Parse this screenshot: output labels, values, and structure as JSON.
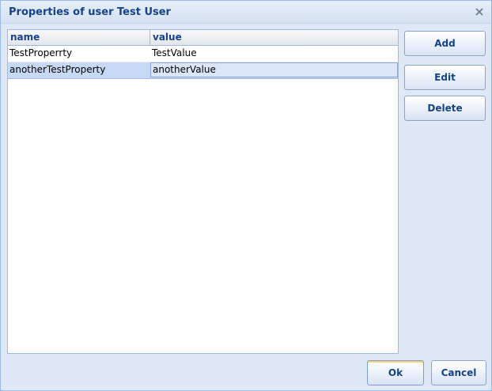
{
  "dialog": {
    "title": "Properties of user Test User",
    "close_glyph": "x"
  },
  "grid": {
    "columns": [
      "name",
      "value"
    ],
    "rows": [
      {
        "name": "TestProperrty",
        "value": "TestValue",
        "selected": false
      },
      {
        "name": "anotherTestProperty",
        "value": "anotherValue",
        "selected": true
      }
    ]
  },
  "side_buttons": {
    "add": "Add",
    "edit": "Edit",
    "delete": "Delete"
  },
  "footer": {
    "ok": "Ok",
    "cancel": "Cancel"
  },
  "colors": {
    "title_text": "#15428b",
    "window_bg": "#dfe8f6",
    "border": "#99bbe8",
    "selected_row": "#c6d9f5"
  }
}
